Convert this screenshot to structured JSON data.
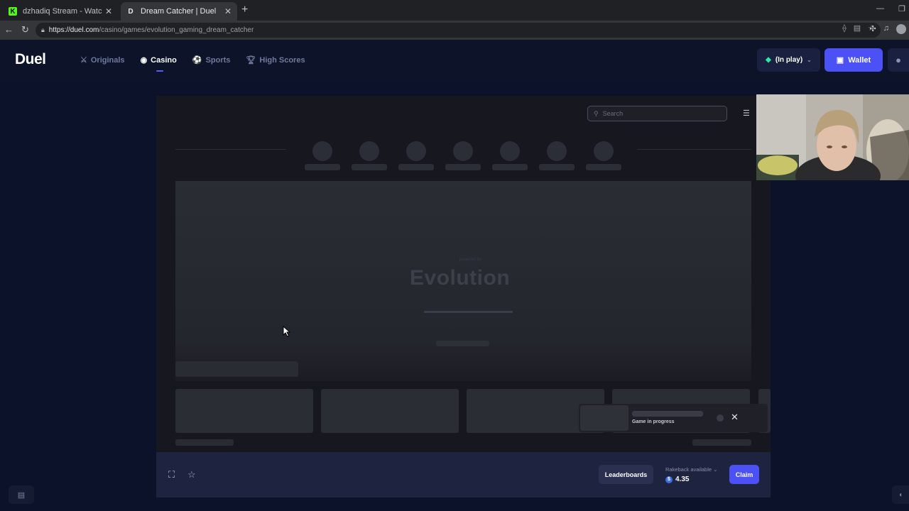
{
  "browser": {
    "tabs": [
      {
        "favicon": "K",
        "title": "dzhadiq Stream - Watch Live on K",
        "active": false
      },
      {
        "favicon": "D",
        "title": "Dream Catcher | Duel",
        "active": true
      }
    ],
    "url_host": "https://duel.com",
    "url_path": "/casino/games/evolution_gaming_dream_catcher"
  },
  "header": {
    "logo": "Duel",
    "nav": [
      {
        "label": "Originals",
        "icon": "crossed-swords-icon",
        "active": false
      },
      {
        "label": "Casino",
        "icon": "casino-chip-icon",
        "active": true
      },
      {
        "label": "Sports",
        "icon": "ball-icon",
        "active": false
      },
      {
        "label": "High Scores",
        "icon": "trophy-icon",
        "active": false
      }
    ],
    "balance_label": "(In play)",
    "wallet_label": "Wallet"
  },
  "game": {
    "search_placeholder": "Search",
    "provider_small": "powered by",
    "provider_logo": "Evolution",
    "toast_text": "Game in progress"
  },
  "bottom": {
    "leaderboards_label": "Leaderboards",
    "rakeback_label": "Rakeback available",
    "rakeback_value": "4.35",
    "claim_label": "Claim"
  },
  "colors": {
    "accent": "#4b51f5",
    "background": "#0c1229",
    "gem": "#2ee6a6"
  }
}
